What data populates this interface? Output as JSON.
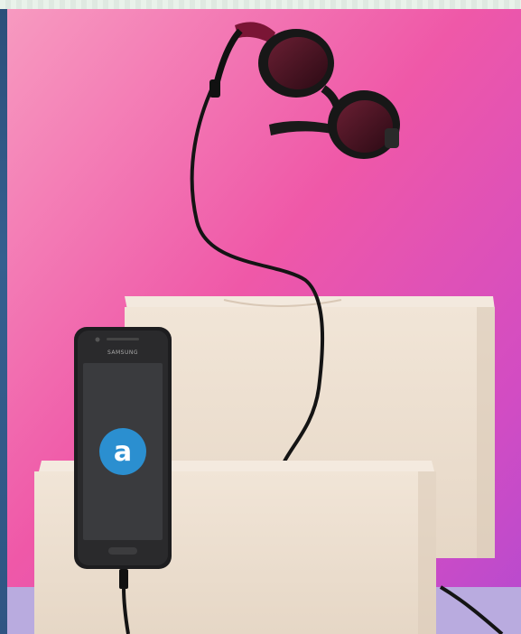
{
  "photo": {
    "description_visible_text": {
      "phone_brand": "SAMSUNG",
      "app_glyph": "a"
    },
    "colors": {
      "backdrop_top": "#f47fb0",
      "backdrop_mid": "#ee4fa6",
      "backdrop_right": "#c44fd0",
      "floor": "#b8a9df",
      "block": "#efe2d3",
      "app_icon": "#2b8fd0"
    }
  }
}
